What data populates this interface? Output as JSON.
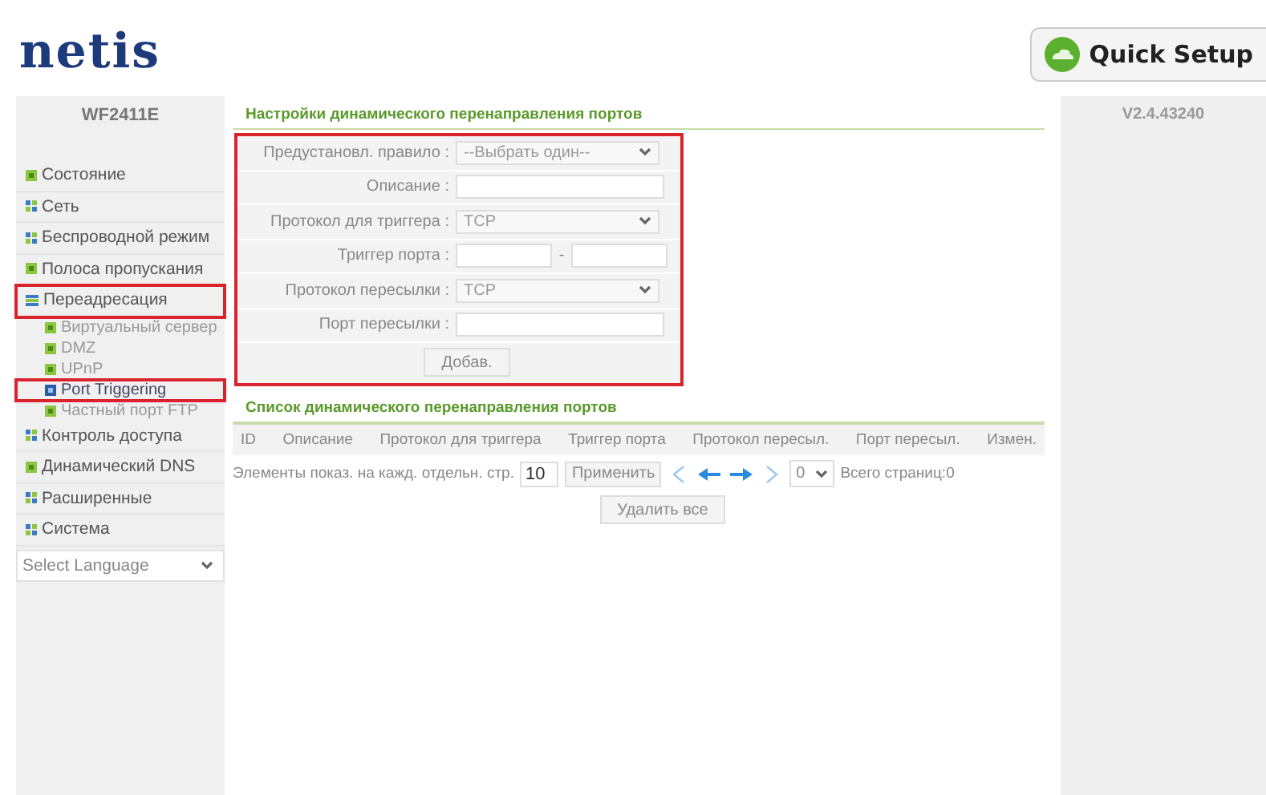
{
  "header": {
    "logo": "netis",
    "quick_setup": "Quick Setup"
  },
  "sidebar": {
    "model": "WF2411E",
    "items": [
      {
        "label": "Состояние",
        "kind": "square",
        "selected": false,
        "highlighted": false
      },
      {
        "label": "Сеть",
        "kind": "grid",
        "selected": false,
        "highlighted": false
      },
      {
        "label": "Беспроводной режим",
        "kind": "grid",
        "selected": false,
        "highlighted": false
      },
      {
        "label": "Полоса пропускания",
        "kind": "square",
        "selected": false,
        "highlighted": false
      },
      {
        "label": "Переадресация",
        "kind": "bars",
        "selected": false,
        "highlighted": true,
        "children": [
          {
            "label": "Виртуальный сервер",
            "selected": false,
            "highlighted": false
          },
          {
            "label": "DMZ",
            "selected": false,
            "highlighted": false
          },
          {
            "label": "UPnP",
            "selected": false,
            "highlighted": false
          },
          {
            "label": "Port Triggering",
            "selected": true,
            "highlighted": true
          },
          {
            "label": "Частный порт FTP",
            "selected": false,
            "highlighted": false
          }
        ]
      },
      {
        "label": "Контроль доступа",
        "kind": "grid",
        "selected": false,
        "highlighted": false
      },
      {
        "label": "Динамический DNS",
        "kind": "square",
        "selected": false,
        "highlighted": false
      },
      {
        "label": "Расширенные",
        "kind": "grid",
        "selected": false,
        "highlighted": false
      },
      {
        "label": "Система",
        "kind": "grid",
        "selected": false,
        "highlighted": false
      }
    ],
    "language": "Select Language"
  },
  "version": "V2.4.43240",
  "settings": {
    "title": "Настройки динамического перенаправления портов",
    "highlighted": true,
    "rows": [
      {
        "kind": "select",
        "label": "Предустановл. правило :",
        "value": "--Выбрать один--"
      },
      {
        "kind": "input",
        "label": "Описание :"
      },
      {
        "kind": "select",
        "label": "Протокол для триггера :",
        "value": "TCP"
      },
      {
        "kind": "range",
        "label": "Триггер порта :",
        "separator": "-"
      },
      {
        "kind": "select",
        "label": "Протокол пересылки :",
        "value": "TCP"
      },
      {
        "kind": "input",
        "label": "Порт пересылки :"
      }
    ],
    "button": "Добав."
  },
  "list": {
    "title": "Список динамического перенаправления портов",
    "columns": [
      "ID",
      "Описание",
      "Протокол для триггера",
      "Триггер порта",
      "Протокол пересыл.",
      "Порт пересыл.",
      "Измен."
    ],
    "per_page_label": "Элементы показ. на кажд. отдельн. стр.",
    "per_page": "10",
    "apply": "Применить",
    "page": "0",
    "total": "Всего страниц:0",
    "delete_all": "Удалить все"
  }
}
